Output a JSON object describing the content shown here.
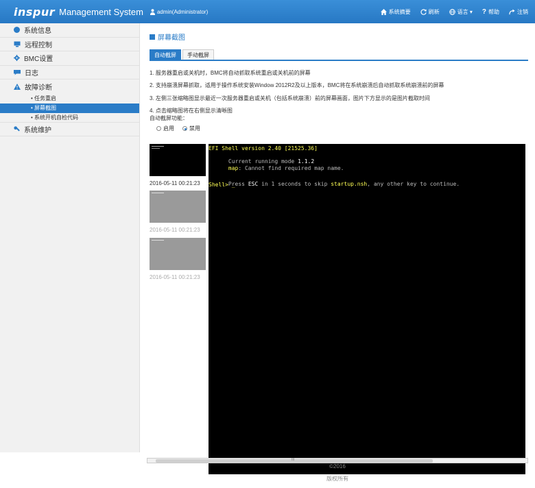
{
  "header": {
    "logo": "inspur",
    "title": "Management System",
    "user": "admin(Administrator)",
    "actions": [
      {
        "icon": "home-icon",
        "label": "系统摘要"
      },
      {
        "icon": "refresh-icon",
        "label": "刷新"
      },
      {
        "icon": "globe-icon",
        "label": "语言 ▾"
      },
      {
        "icon": "help-icon",
        "label": "帮助"
      },
      {
        "icon": "logout-icon",
        "label": "注销"
      }
    ]
  },
  "sidebar": {
    "items": [
      {
        "icon": "info-icon",
        "label": "系统信息"
      },
      {
        "icon": "monitor-icon",
        "label": "远程控制"
      },
      {
        "icon": "gear-icon",
        "label": "BMC设置"
      },
      {
        "icon": "log-icon",
        "label": "日志"
      },
      {
        "icon": "warning-icon",
        "label": "故障诊断"
      },
      {
        "icon": "wrench-icon",
        "label": "系统维护"
      }
    ],
    "subitems": [
      {
        "label": "• 任务重启",
        "active": false
      },
      {
        "label": "• 屏幕截图",
        "active": true
      },
      {
        "label": "• 系统开机自检代码",
        "active": false
      }
    ]
  },
  "main": {
    "title": "屏幕截图",
    "tabs": [
      "自动截屏",
      "手动截屏"
    ],
    "notes": [
      "1. 服务器重启或关机时，BMC将自动抓取系统重启或关机前的屏幕",
      "2. 支持崩溃屏幕抓取，适用于操作系统安装Window 2012R2及以上版本，BMC将在系统崩溃后自动抓取系统崩溃前的屏幕",
      "3. 左侧三张缩略图显示最近一次服务器重启或关机（包括系统崩溃）前的屏幕画面，图片下方显示的是图片截取时间",
      "4. 点击缩略图将在右侧显示清晰图"
    ],
    "auto_label": "自动截屏功能：",
    "radio_on": "启用",
    "radio_off": "禁用",
    "selected": "禁用",
    "thumbs": [
      {
        "time": "2016-05-11 00:21:23"
      },
      {
        "time": "2016-05-11 00:21:23"
      },
      {
        "time": "2016-05-11 00:21:23"
      }
    ],
    "screen": {
      "l1": "EFI Shell version 2.40 [21525.36]",
      "l2a": "Current running mode ",
      "l2b": "1.1.2",
      "l3a": "map",
      "l3b": ": Cannot find required map name.",
      "l4a": "Press ",
      "l4b": "ESC",
      "l4c": " in 1 seconds to skip ",
      "l4d": "startup.nsh",
      "l4e": ", any other key to continue.",
      "l5": "Shell> _"
    },
    "scroll_label": "III"
  },
  "footer": {
    "copyright": "©2016",
    "rights": "版权所有"
  }
}
